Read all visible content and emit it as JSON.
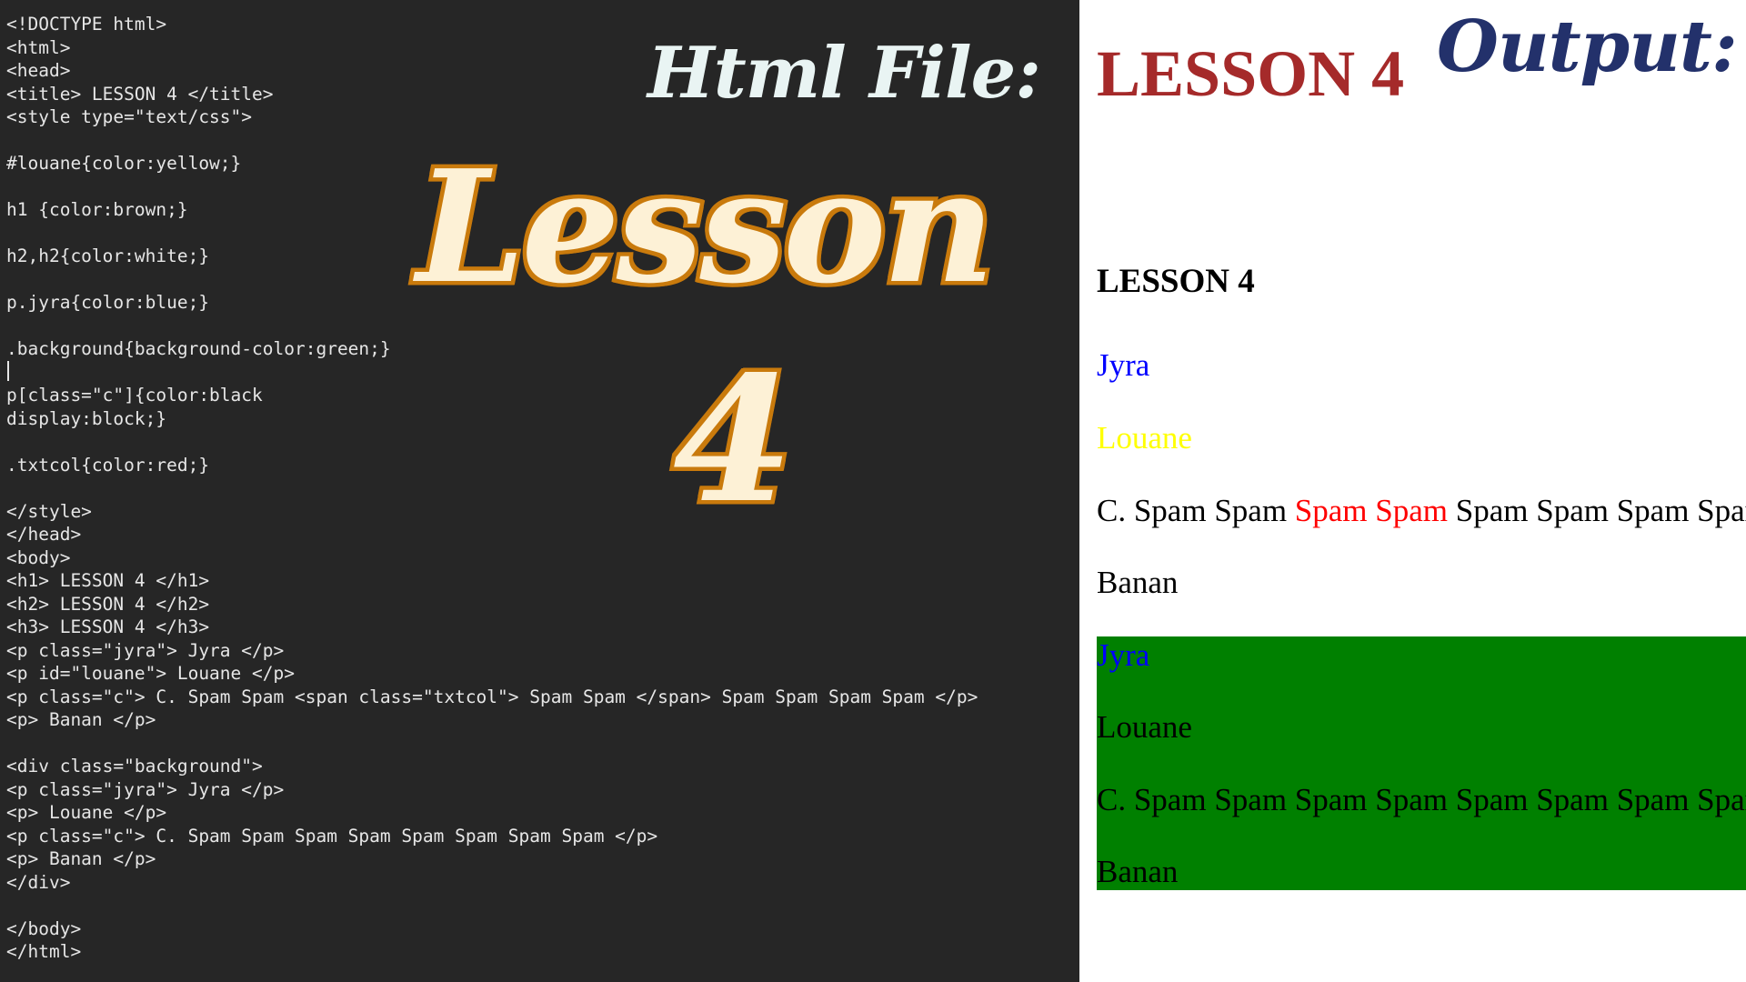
{
  "editor": {
    "code_lines": [
      "<!DOCTYPE html>",
      "<html>",
      "<head>",
      "<title> LESSON 4 </title>",
      "<style type=\"text/css\">",
      "",
      "#louane{color:yellow;}",
      "",
      "h1 {color:brown;}",
      "",
      "h2,h2{color:white;}",
      "",
      "p.jyra{color:blue;}",
      "",
      ".background{background-color:green;}",
      "",
      "p[class=\"c\"]{color:black",
      "display:block;}",
      "",
      ".txtcol{color:red;}",
      "",
      "</style>",
      "</head>",
      "<body>",
      "<h1> LESSON 4 </h1>",
      "<h2> LESSON 4 </h2>",
      "<h3> LESSON 4 </h3>",
      "<p class=\"jyra\"> Jyra </p>",
      "<p id=\"louane\"> Louane </p>",
      "<p class=\"c\"> C. Spam Spam <span class=\"txtcol\"> Spam Spam </span> Spam Spam Spam Spam </p>",
      "<p> Banan </p>",
      "",
      "<div class=\"background\">",
      "<p class=\"jyra\"> Jyra </p>",
      "<p> Louane </p>",
      "<p class=\"c\"> C. Spam Spam Spam Spam Spam Spam Spam Spam </p>",
      "<p> Banan </p>",
      "</div>",
      "",
      "</body>",
      "</html>"
    ]
  },
  "overlay": {
    "html_file_label": "Html File:",
    "lesson_word": "Lesson",
    "lesson_number": "4",
    "output_label": "Output:"
  },
  "output": {
    "h1": "LESSON 4",
    "h3": "LESSON 4",
    "p_jyra": "Jyra",
    "p_louane": "Louane",
    "p_c_part1": "C. Spam Spam ",
    "p_c_red": "Spam Spam",
    "p_c_part2": " Spam Spam Spam Spam",
    "p_banan": "Banan",
    "box_jyra": "Jyra",
    "box_louane": "Louane",
    "box_c": "C. Spam Spam Spam Spam Spam Spam Spam Spam",
    "box_banan": "Banan"
  },
  "colors": {
    "editor_bg": "#262626",
    "h1_brown": "#a52a2a",
    "jyra_blue": "#0000ff",
    "louane_yellow": "#ffff00",
    "txtcol_red": "#ff0000",
    "background_green": "#008000",
    "lesson_fill": "#fdf1d6",
    "lesson_outline": "#c97a0c",
    "output_label": "#23316b"
  }
}
